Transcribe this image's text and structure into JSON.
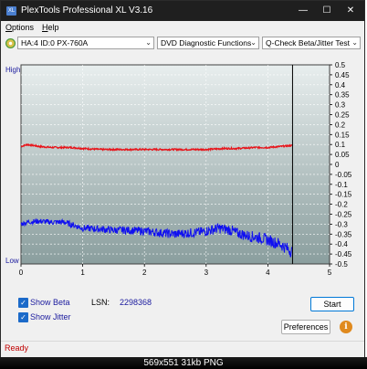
{
  "window": {
    "title": "PlexTools Professional XL V3.16",
    "icon_text": "XL",
    "minimize_glyph": "—",
    "maximize_glyph": "☐",
    "close_glyph": "✕"
  },
  "menu": {
    "items": [
      {
        "label": "Options",
        "accel": "O"
      },
      {
        "label": "Help",
        "accel": "H"
      }
    ]
  },
  "toolbar": {
    "drive": "HA:4 ID:0  PX-760A",
    "function": "DVD Diagnostic Functions",
    "test": "Q-Check Beta/Jitter Test",
    "dropdown_glyph": "⌄"
  },
  "chart_data": {
    "type": "line",
    "x_ticks": [
      "0",
      "1",
      "2",
      "3",
      "4",
      "5"
    ],
    "xlim": [
      0,
      5
    ],
    "left_axis_labels": {
      "top": "High",
      "bottom": "Low"
    },
    "right_ticks": [
      "0.5",
      "0.45",
      "0.4",
      "0.35",
      "0.3",
      "0.25",
      "0.2",
      "0.15",
      "0.1",
      "0.05",
      "0",
      "-0.05",
      "-0.1",
      "-0.15",
      "-0.2",
      "-0.25",
      "-0.3",
      "-0.35",
      "-0.4",
      "-0.45",
      "-0.5"
    ],
    "ylim": [
      -0.5,
      0.5
    ],
    "end_marker_x": 4.4,
    "grid": true,
    "colors": {
      "beta": "#e8141a",
      "jitter": "#1010f0",
      "plot_bg_top": "#e8eeee",
      "plot_bg_bottom": "#8a9e9e",
      "grid": "#ffffff"
    },
    "series": [
      {
        "name": "Beta",
        "color": "#e8141a",
        "x": [
          0,
          0.1,
          0.3,
          0.5,
          0.8,
          1.0,
          1.3,
          1.5,
          1.8,
          2.0,
          2.3,
          2.5,
          2.8,
          3.0,
          3.3,
          3.5,
          3.8,
          4.0,
          4.2,
          4.4
        ],
        "y": [
          0.09,
          0.1,
          0.09,
          0.085,
          0.085,
          0.08,
          0.075,
          0.075,
          0.075,
          0.075,
          0.075,
          0.075,
          0.075,
          0.075,
          0.08,
          0.08,
          0.085,
          0.085,
          0.09,
          0.095
        ]
      },
      {
        "name": "Jitter",
        "x": [
          0,
          0.1,
          0.3,
          0.5,
          0.7,
          0.8,
          1.0,
          1.3,
          1.5,
          1.7,
          2.0,
          2.3,
          2.5,
          2.7,
          2.9,
          3.0,
          3.2,
          3.4,
          3.5,
          3.7,
          3.9,
          4.0,
          4.1,
          4.2,
          4.3,
          4.4
        ],
        "y": [
          -0.3,
          -0.29,
          -0.285,
          -0.29,
          -0.29,
          -0.3,
          -0.32,
          -0.325,
          -0.33,
          -0.33,
          -0.335,
          -0.345,
          -0.35,
          -0.345,
          -0.34,
          -0.335,
          -0.32,
          -0.33,
          -0.345,
          -0.36,
          -0.37,
          -0.38,
          -0.39,
          -0.4,
          -0.42,
          -0.44
        ]
      }
    ]
  },
  "controls": {
    "show_beta_label": "Show Beta",
    "show_beta_checked": true,
    "show_jitter_label": "Show Jitter",
    "show_jitter_checked": true,
    "check_glyph": "✓",
    "lsn_label": "LSN:",
    "lsn_value": "2298368",
    "start_label": "Start",
    "preferences_label": "Preferences",
    "info_glyph": "i"
  },
  "status": {
    "text": "Ready"
  },
  "caption": {
    "text": "569x551  31kb  PNG"
  }
}
